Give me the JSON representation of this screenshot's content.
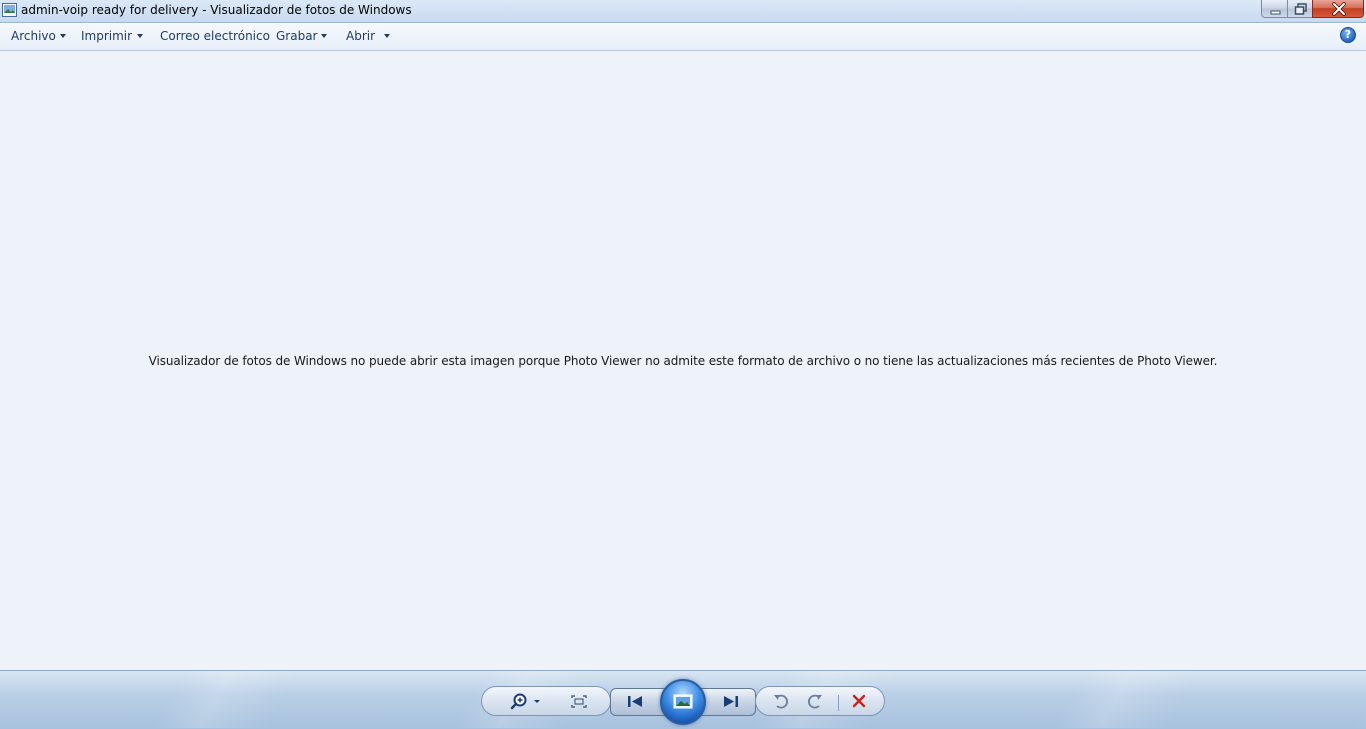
{
  "window": {
    "title": "admin-voip ready for delivery - Visualizador de fotos de Windows"
  },
  "window_controls": {
    "minimize_icon": "minimize-icon",
    "maximize_icon": "restore-icon",
    "close_icon": "close-icon"
  },
  "menu": {
    "items": [
      {
        "label": "Archivo",
        "has_dropdown": true
      },
      {
        "label": "Imprimir",
        "has_dropdown": true
      },
      {
        "label": "Correo electrónico",
        "has_dropdown": false
      },
      {
        "label": "Grabar",
        "has_dropdown": true
      },
      {
        "label": "Abrir",
        "has_dropdown": true
      }
    ],
    "help_label": "?"
  },
  "content": {
    "error_message": "Visualizador de fotos de Windows no puede abrir esta imagen porque Photo Viewer no admite este formato de archivo o no tiene las actualizaciones más recientes de Photo Viewer."
  },
  "toolbar": {
    "buttons": [
      "zoom-icon",
      "actual-size-icon",
      "previous-icon",
      "slideshow-icon",
      "next-icon",
      "rotate-counterclockwise-icon",
      "rotate-clockwise-icon",
      "delete-icon"
    ]
  },
  "colors": {
    "title_bar": "#c8daf0",
    "menu_text": "#1e3a5f",
    "content_bg": "#eef2f9",
    "delete_red": "#c8231b",
    "slideshow_blue": "#1556b3"
  }
}
